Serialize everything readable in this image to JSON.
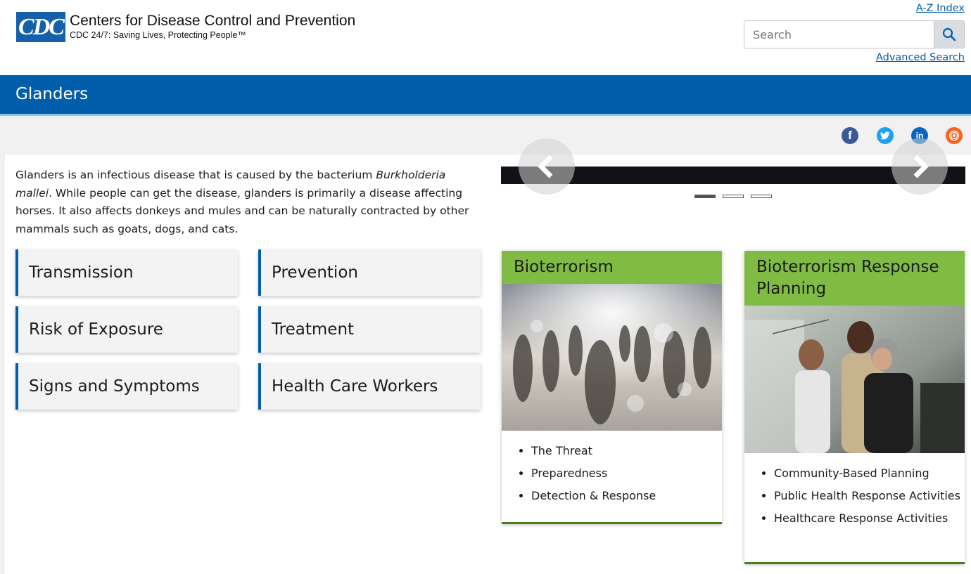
{
  "header": {
    "logo_text": "CDC",
    "org_name": "Centers for Disease Control and Prevention",
    "tagline": "CDC 24/7: Saving Lives, Protecting People™",
    "az_index": "A-Z Index",
    "search_placeholder": "Search",
    "advanced_search": "Advanced Search"
  },
  "page": {
    "title": "Glanders"
  },
  "social": {
    "icons": [
      "facebook-icon",
      "twitter-icon",
      "linkedin-icon",
      "syndicate-icon"
    ]
  },
  "intro": {
    "before": "Glanders is an infectious disease that is caused by the bacterium ",
    "italic": "Burkholderia mallei",
    "after": ". While people can get the disease, glanders is primarily a disease affecting horses. It also affects donkeys and mules and can be naturally contracted by other mammals such as goats, dogs, and cats."
  },
  "nav_cards": [
    "Transmission",
    "Prevention",
    "Risk of Exposure",
    "Treatment",
    "Signs and Symptoms",
    "Health Care Workers"
  ],
  "carousel": {
    "slides": 3,
    "active": 1
  },
  "features": [
    {
      "title": "Bioterrorism",
      "links": [
        "The Threat",
        "Preparedness",
        "Detection & Response"
      ]
    },
    {
      "title": "Bioterrorism Response Planning",
      "links": [
        "Community-Based Planning",
        "Public Health Response Activities",
        "Healthcare Response Activities"
      ]
    }
  ],
  "colors": {
    "brand_blue": "#005eaa",
    "feature_green": "#80bc44",
    "feature_border": "#4a7f18"
  }
}
